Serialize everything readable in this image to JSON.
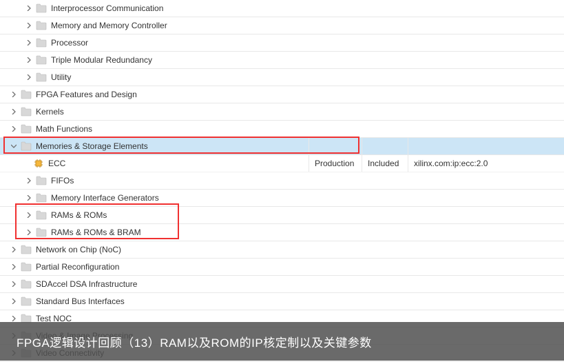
{
  "tree": {
    "items_level1_before": [
      "Interprocessor Communication",
      "Memory and Memory Controller",
      "Processor",
      "Triple Modular Redundancy",
      "Utility"
    ],
    "items_level0_before": [
      "FPGA Features and Design",
      "Kernels",
      "Math Functions"
    ],
    "memories_label": "Memories & Storage Elements",
    "ecc": {
      "label": "ECC",
      "status": "Production",
      "license": "Included",
      "vlnv": "xilinx.com:ip:ecc:2.0"
    },
    "memories_children": [
      "FIFOs",
      "Memory Interface Generators",
      "RAMs & ROMs",
      "RAMs & ROMs & BRAM"
    ],
    "items_level0_after": [
      "Network on Chip (NoC)",
      "Partial Reconfiguration",
      "SDAccel DSA Infrastructure",
      "Standard Bus Interfaces",
      "Test NOC",
      "Video & Image Processing",
      "Video Connectivity"
    ]
  },
  "caption": "FPGA逻辑设计回顾（13）RAM以及ROM的IP核定制以及关键参数"
}
